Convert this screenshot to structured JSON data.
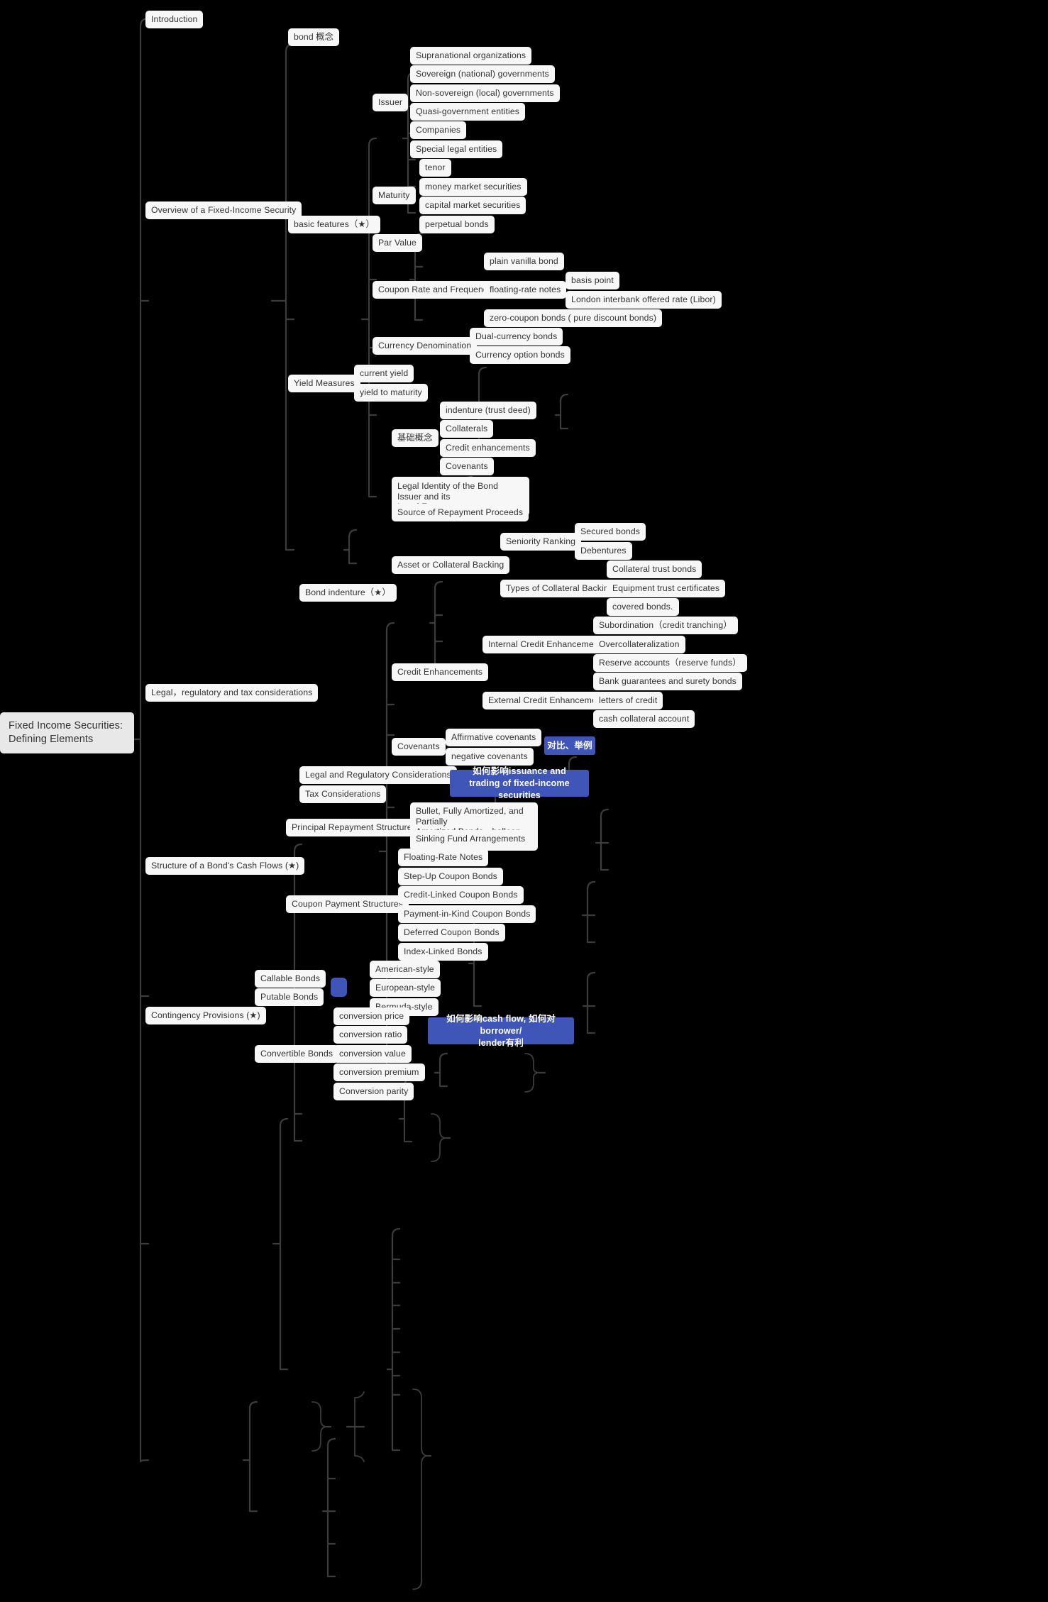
{
  "meta": {
    "title": "Fixed Income Securities: Defining Elements",
    "type": "mindmap",
    "background": "#000000",
    "node_fill": "#f7f7f7",
    "node_text": "#333333",
    "accent": "#4055b8",
    "edge_color": "#3c3c3c"
  },
  "nodes": {
    "root": "Fixed Income Securities:\nDefining Elements",
    "introduction": "Introduction",
    "overview": "Overview of a Fixed-Income Security",
    "bond_concept": "bond 概念",
    "basic_features": "basic features（★）",
    "issuer": "Issuer",
    "issuer_items": [
      "Supranational organizations",
      "Sovereign (national) governments",
      "Non-sovereign (local) governments",
      "Quasi-government entities",
      "Companies",
      "Special legal entities"
    ],
    "maturity": "Maturity",
    "maturity_items": [
      "tenor",
      "money market securities",
      "capital market securities",
      "perpetual bonds"
    ],
    "par_value": "Par Value",
    "coupon_rate": "Coupon Rate and Frequency",
    "coupon_items": [
      "plain vanilla bond",
      "floating-rate notes",
      "zero-coupon bonds ( pure discount bonds)"
    ],
    "frn_items": [
      "basis point",
      "London interbank offered rate (Libor)"
    ],
    "currency_denomination": "Currency Denomination",
    "currency_items": [
      "Dual-currency bonds",
      "Currency option bonds"
    ],
    "yield_measures": "Yield Measures",
    "yield_items": [
      "current yield",
      "yield to maturity"
    ],
    "legal_regulatory_tax": "Legal，regulatory and tax considerations",
    "bond_indenture": "Bond indenture（★）",
    "basic_concepts": "基础概念",
    "basic_concepts_items": [
      "indenture (trust deed)",
      "Collaterals",
      "Credit enhancements",
      "Covenants"
    ],
    "legal_identity": "Legal Identity of the Bond Issuer and its\nLegal Form",
    "source_repayment": "Source of Repayment Proceeds",
    "asset_collateral": "Asset or Collateral Backing",
    "seniority_ranking": "Seniority Ranking",
    "seniority_items": [
      "Secured bonds",
      "Debentures"
    ],
    "types_collateral": "Types of Collateral Backing",
    "types_collateral_items": [
      "Collateral trust bonds",
      "Equipment trust certificates",
      "covered bonds."
    ],
    "credit_enhancements": "Credit Enhancements",
    "internal_credit": "Internal Credit Enhancement",
    "internal_items": [
      "Subordination（credit tranching）",
      "Overcollateralization",
      "Reserve accounts（reserve funds）"
    ],
    "external_credit": "External Credit Enhancement",
    "external_items": [
      "Bank guarantees and surety bonds",
      "letters of credit",
      "cash collateral account"
    ],
    "covenants": "Covenants",
    "covenants_items": [
      "Affirmative covenants",
      "negative covenants"
    ],
    "note_compare": "对比、举例",
    "legal_regulatory_considerations": "Legal and Regulatory Considerations",
    "tax_considerations": "Tax Considerations",
    "note_issuance": "如何影响issuance and\ntrading of fixed-income securities",
    "cash_flows": "Structure of a Bond's Cash Flows (★)",
    "principal_repayment": "Principal Repayment Structures",
    "principal_items": [
      "Bullet, Fully Amortized, and Partially\nAmortized Bonds，balloon payment",
      "Sinking Fund Arrangements"
    ],
    "coupon_payment": "Coupon Payment Structures",
    "coupon_payment_items": [
      "Floating-Rate Notes",
      "Step-Up Coupon Bonds",
      "Credit-Linked Coupon Bonds",
      "Payment-in-Kind Coupon Bonds",
      "Deferred Coupon Bonds",
      "Index-Linked Bonds"
    ],
    "contingency": "Contingency Provisions (★)",
    "callable_bonds": "Callable Bonds",
    "putable_bonds": "Putable Bonds",
    "style_items": [
      "American-style",
      "European-style",
      "Bermuda-style"
    ],
    "convertible_bonds": "Convertible Bonds",
    "conversion_items": [
      "conversion price",
      "conversion ratio",
      "conversion value",
      "conversion premium",
      "Conversion parity"
    ],
    "note_cashflow": "如何影响cash flow, 如何对borrower/\nlender有利"
  }
}
